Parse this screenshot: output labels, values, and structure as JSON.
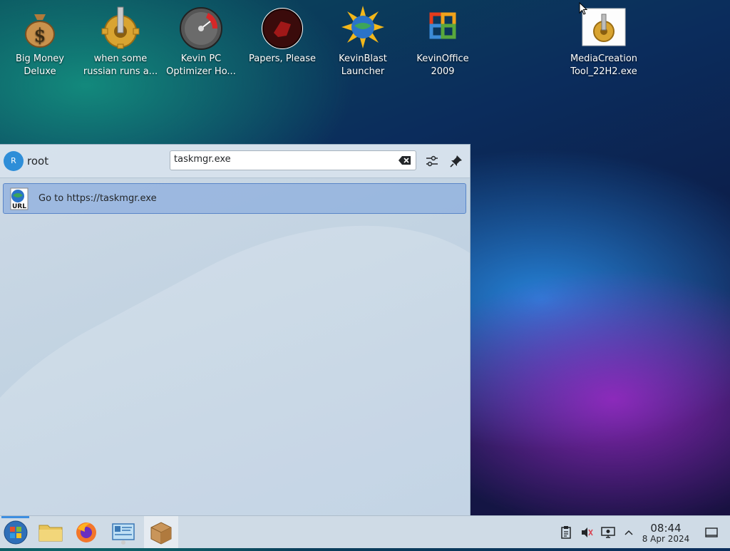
{
  "desktop": {
    "icons": [
      {
        "label1": "Big Money",
        "label2": "Deluxe"
      },
      {
        "label1": "when some",
        "label2": "russian runs a..."
      },
      {
        "label1": "Kevin PC",
        "label2": "Optimizer Ho..."
      },
      {
        "label1": "Papers, Please",
        "label2": ""
      },
      {
        "label1": "KevinBlast",
        "label2": "Launcher"
      },
      {
        "label1": "KevinOffice",
        "label2": "2009"
      },
      {
        "label1": "MediaCreation",
        "label2": "Tool_22H2.exe"
      }
    ]
  },
  "launcher": {
    "avatar_letter": "R",
    "username": "root",
    "search_value": "taskmgr.exe",
    "result": {
      "text": "Go to https://taskmgr.exe",
      "icon_label": "URL"
    }
  },
  "taskbar": {
    "time": "08:44",
    "date": "8 Apr 2024"
  },
  "colors": {
    "accent": "#3d8ee0",
    "selection": "#5a86c8"
  }
}
